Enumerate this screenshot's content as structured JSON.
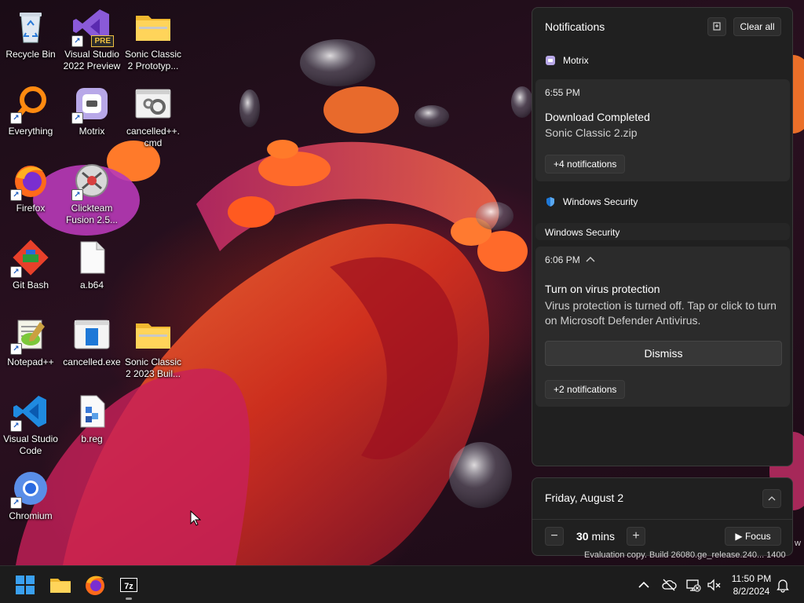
{
  "desktop": {
    "icons": [
      {
        "label": "Recycle Bin",
        "icon": "recycle-bin-icon"
      },
      {
        "label": "Visual Studio\n2022 Preview",
        "icon": "visual-studio-icon",
        "badge": "PRE"
      },
      {
        "label": "Sonic Classic\n2 Prototyp...",
        "icon": "folder-icon"
      },
      {
        "label": "Everything",
        "icon": "everything-search-icon"
      },
      {
        "label": "Motrix",
        "icon": "motrix-icon"
      },
      {
        "label": "cancelled++.\ncmd",
        "icon": "cmd-script-icon"
      },
      {
        "label": "Firefox",
        "icon": "firefox-icon"
      },
      {
        "label": "Clickteam\nFusion 2.5...",
        "icon": "clickteam-fusion-icon"
      },
      {
        "label": "Git Bash",
        "icon": "git-bash-icon"
      },
      {
        "label": "a.b64",
        "icon": "blank-file-icon"
      },
      {
        "label": "Notepad++",
        "icon": "notepadpp-icon"
      },
      {
        "label": "cancelled.exe",
        "icon": "exe-icon"
      },
      {
        "label": "Sonic Classic\n2 2023 Buil...",
        "icon": "folder-icon"
      },
      {
        "label": "Visual Studio\nCode",
        "icon": "vscode-icon"
      },
      {
        "label": "b.reg",
        "icon": "registry-file-icon"
      },
      {
        "label": "Chromium",
        "icon": "chromium-icon"
      }
    ]
  },
  "notifications": {
    "title": "Notifications",
    "clear_all": "Clear all",
    "groups": [
      {
        "app": "Motrix",
        "time": "6:55 PM",
        "title": "Download Completed",
        "body": "Sonic Classic 2.zip",
        "more": "+4 notifications"
      },
      {
        "app": "Windows Security",
        "collapsed_header": "Windows Security",
        "time": "6:06 PM",
        "title": "Turn on virus protection",
        "body": "Virus protection is turned off. Tap or click to turn on Microsoft Defender Antivirus.",
        "action": "Dismiss",
        "more": "+2 notifications"
      }
    ]
  },
  "calendar": {
    "date": "Friday, August 2",
    "focus_minutes": "30",
    "focus_unit": "mins",
    "focus_label": "Focus"
  },
  "watermark": {
    "line1": "w",
    "line2": "Evaluation copy. Build 26080.ge_release.240... 1400"
  },
  "taskbar": {
    "apps": [
      "windows-start-icon",
      "file-explorer-icon",
      "firefox-icon",
      "7zip-icon"
    ],
    "clock_time": "11:50 PM",
    "clock_date": "8/2/2024"
  },
  "colors": {
    "panel_bg": "#202020",
    "card_bg": "#2b2b2b",
    "taskbar_bg": "#1c1c1c",
    "shield_blue": "#1e78d7"
  }
}
